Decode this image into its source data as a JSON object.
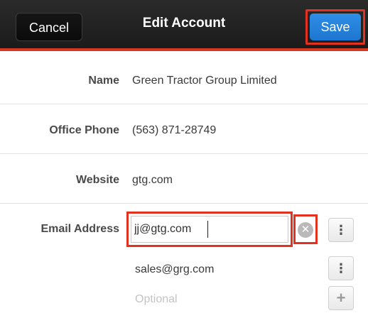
{
  "header": {
    "title": "Edit Account",
    "cancel_label": "Cancel",
    "save_label": "Save"
  },
  "fields": {
    "name": {
      "label": "Name",
      "value": "Green Tractor Group Limited"
    },
    "office_phone": {
      "label": "Office Phone",
      "value": "(563) 871-28749"
    },
    "website": {
      "label": "Website",
      "value": "gtg.com"
    },
    "email": {
      "label": "Email Address",
      "primary_value": "jj@gtg.com",
      "secondary_value": "sales@grg.com",
      "new_placeholder": "Optional",
      "clear_icon": "clear-x-icon",
      "menu_icon": "vertical-ellipsis-icon",
      "add_icon": "plus-icon",
      "menu_glyph": "⋮",
      "add_glyph": "+",
      "clear_glyph": "✕"
    }
  },
  "colors": {
    "header_bg": "#1f1f1f",
    "header_accent": "#d6391f",
    "save_blue": "#2385dc",
    "highlight_red": "#e0321e"
  }
}
